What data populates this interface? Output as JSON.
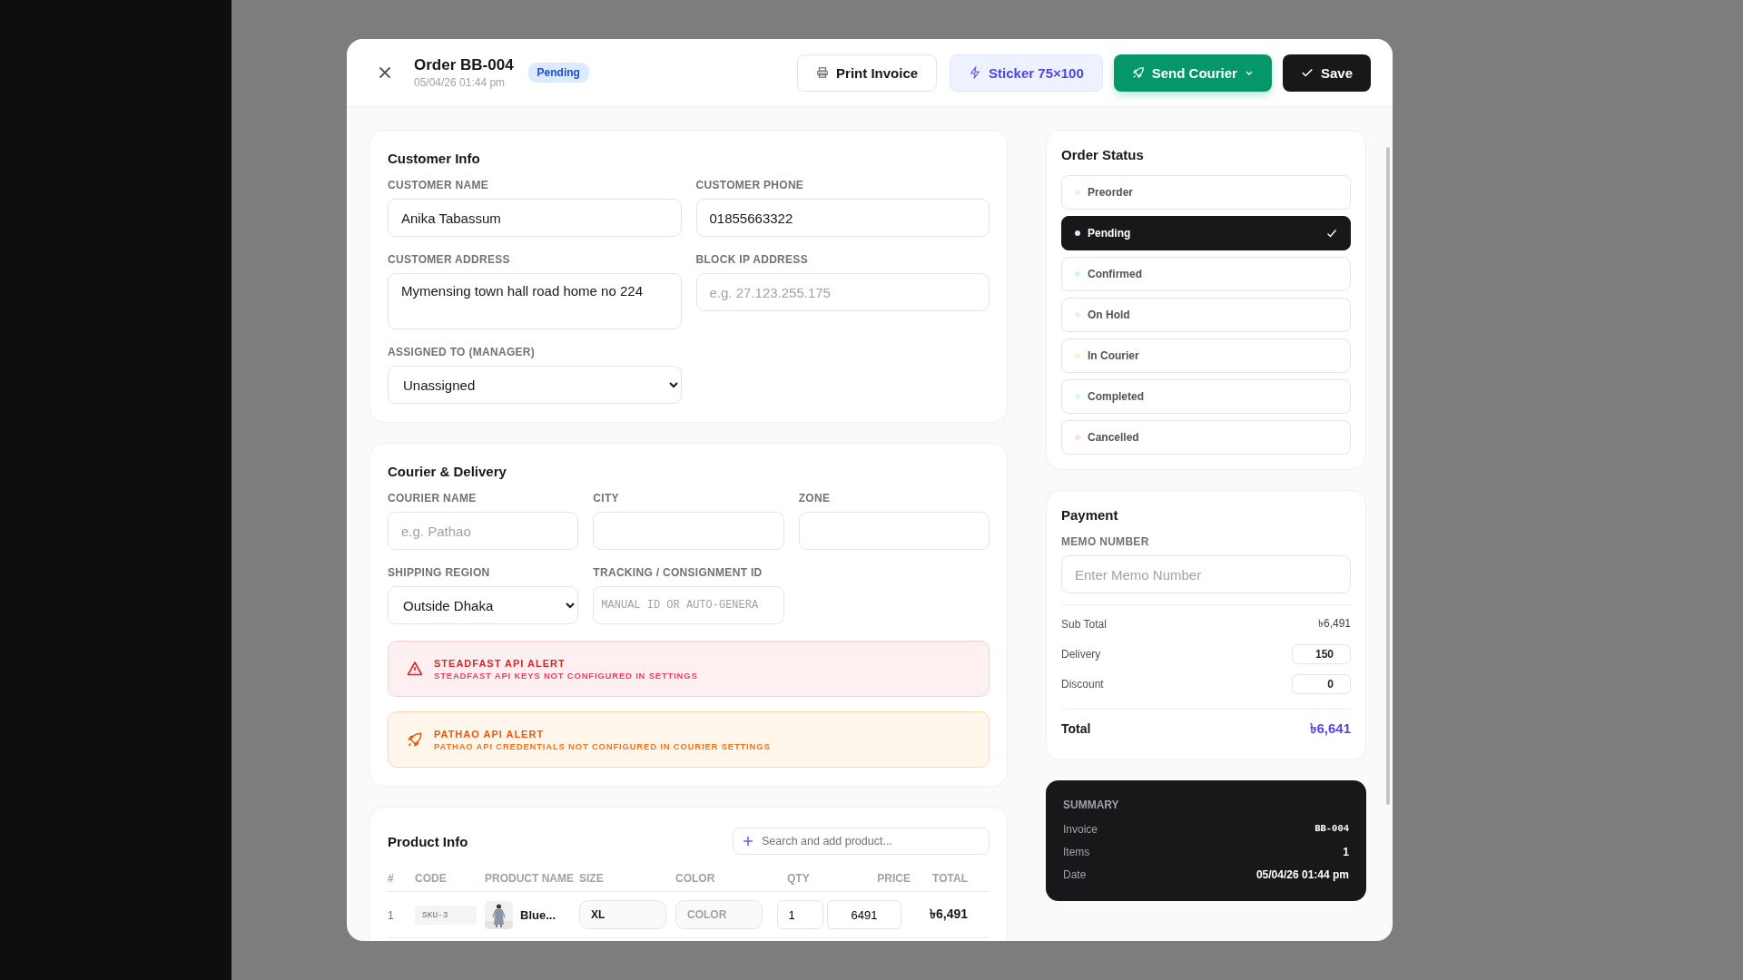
{
  "header": {
    "title": "Order BB-004",
    "date": "05/04/26 01:44 pm",
    "badge": "Pending",
    "buttons": [
      {
        "label": "Print Invoice",
        "kind": "outline"
      },
      {
        "label": "Sticker 75×100",
        "kind": "soft"
      },
      {
        "label": "Send Courier",
        "kind": "primary"
      },
      {
        "label": "Save",
        "kind": "dark"
      }
    ]
  },
  "customer_info": {
    "title": "Customer Info",
    "fields": [
      {
        "label": "CUSTOMER NAME",
        "kind": "input",
        "value": "Anika Tabassum"
      },
      {
        "label": "CUSTOMER PHONE",
        "kind": "input",
        "value": "01855663322"
      },
      {
        "label": "CUSTOMER ADDRESS",
        "kind": "textarea",
        "value": "Mymensing town hall road home no 224"
      },
      {
        "label": "BLOCK IP ADDRESS",
        "kind": "input",
        "placeholder": "e.g. 27.123.255.175"
      },
      {
        "label": "ASSIGNED TO (MANAGER)",
        "kind": "select",
        "value": "Unassigned"
      }
    ]
  },
  "courier_delivery": {
    "title": "Courier & Delivery",
    "fields": [
      {
        "label": "COURIER NAME",
        "kind": "input",
        "placeholder": "e.g. Pathao"
      },
      {
        "label": "CITY",
        "kind": "input"
      },
      {
        "label": "ZONE",
        "kind": "input"
      },
      {
        "label": "SHIPPING REGION",
        "kind": "select",
        "value": "Outside Dhaka"
      },
      {
        "label": "TRACKING / CONSIGNMENT ID",
        "kind": "mono",
        "placeholder": "MANUAL ID OR AUTO-GENERA"
      }
    ],
    "alerts": [
      {
        "kind": "error",
        "title": "STEADFAST API ALERT",
        "message": "STEADFAST API KEYS NOT CONFIGURED IN SETTINGS"
      },
      {
        "kind": "warning",
        "title": "PATHAO API ALERT",
        "message": "PATHAO API CREDENTIALS NOT CONFIGURED IN COURIER SETTINGS"
      }
    ]
  },
  "product_info": {
    "title": "Product Info",
    "search": {
      "placeholder": "Search and add product..."
    },
    "columns": [
      "#",
      "CODE",
      "PRODUCT NAME",
      "SIZE",
      "COLOR",
      "QTY",
      "PRICE",
      "TOTAL"
    ],
    "rows": [
      {
        "number": "1",
        "code": "SKU-3",
        "name": "Blue...",
        "size": "XL",
        "color_placeholder": "COLOR",
        "qty": "1",
        "price": "6491",
        "total": "৳6,491"
      }
    ]
  },
  "order_status": {
    "title": "Order Status",
    "options": [
      {
        "label": "Preorder",
        "color": "#fce7f3",
        "selected": false
      },
      {
        "label": "Pending",
        "color": "#dbeafe",
        "selected": true
      },
      {
        "label": "Confirmed",
        "color": "#ccfbf1",
        "selected": false
      },
      {
        "label": "On Hold",
        "color": "#ede9fe",
        "selected": false
      },
      {
        "label": "In Courier",
        "color": "#ffedd5",
        "selected": false
      },
      {
        "label": "Completed",
        "color": "#dcfce7",
        "selected": false
      },
      {
        "label": "Cancelled",
        "color": "#fee2e2",
        "selected": false
      }
    ]
  },
  "payment": {
    "title": "Payment",
    "memo": {
      "label": "MEMO NUMBER",
      "placeholder": "Enter Memo Number"
    },
    "sub_total": {
      "label": "Sub Total",
      "value": "৳6,491"
    },
    "delivery": {
      "label": "Delivery",
      "value": "150"
    },
    "discount": {
      "label": "Discount",
      "value": "0"
    },
    "total": {
      "label": "Total",
      "value": "৳6,641"
    }
  },
  "summary": {
    "title": "SUMMARY",
    "rows": [
      {
        "label": "Invoice",
        "value": "BB-004",
        "kind": "code"
      },
      {
        "label": "Items",
        "value": "1",
        "kind": "text"
      },
      {
        "label": "Date",
        "value": "05/04/26 01:44 pm",
        "kind": "text"
      }
    ]
  }
}
